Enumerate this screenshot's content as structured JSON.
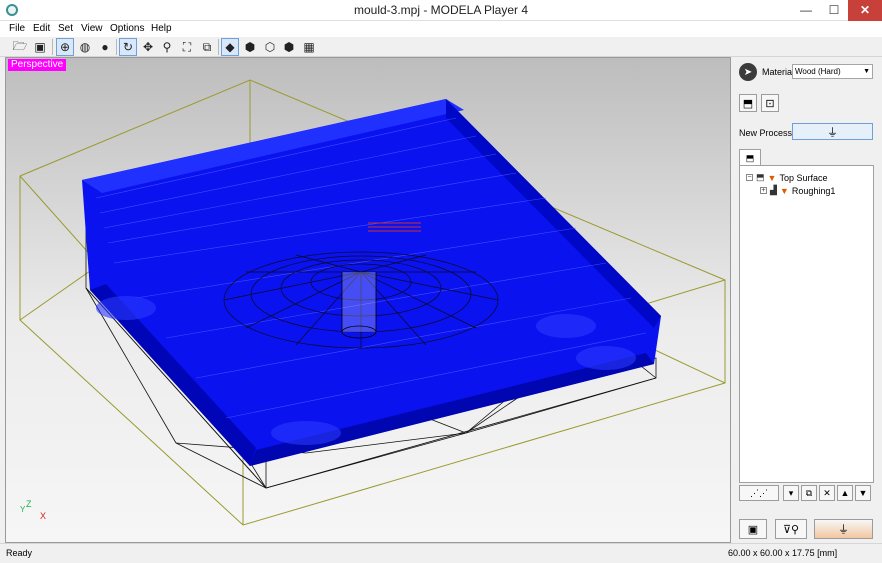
{
  "window": {
    "title": "mould-3.mpj - MODELA Player 4",
    "minimize": "—",
    "maximize": "☐",
    "close": "✕"
  },
  "menu": [
    "File",
    "Edit",
    "Set",
    "View",
    "Options",
    "Help"
  ],
  "toolbar": {
    "icons": [
      "open-icon",
      "save-icon",
      "wire-icon",
      "wire-sphere-icon",
      "solid-sphere-icon",
      "rotate-icon",
      "pan-icon",
      "zoom-icon",
      "fit-icon",
      "zoom-window-icon",
      "view-iso-icon",
      "view-front-icon",
      "view-side-icon",
      "view-back-icon",
      "view-grid-icon"
    ]
  },
  "viewport": {
    "mode_label": "Perspective",
    "axis_z": "Z",
    "axis_y": "Y",
    "axis_x": "X",
    "colors": {
      "toolpath": "#0000ff",
      "bounds": "#9a9a30",
      "mesh": "#000000",
      "label_bg": "#ff00ff"
    }
  },
  "panel": {
    "material_label": "Material",
    "material_value": "Wood (Hard)",
    "new_process_label": "New Process",
    "tree": {
      "root": "Top Surface",
      "child": "Roughing1"
    }
  },
  "status": {
    "left": "Ready",
    "right": "60.00 x 60.00 x 17.75 [mm]"
  }
}
